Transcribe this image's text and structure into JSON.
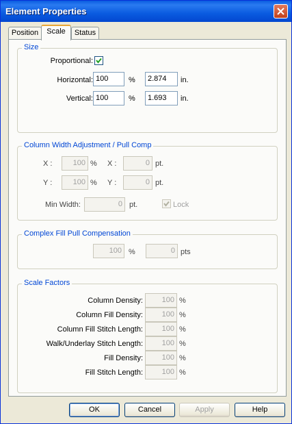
{
  "window": {
    "title": "Element Properties"
  },
  "tabs": [
    "Position",
    "Scale",
    "Status"
  ],
  "size": {
    "legend": "Size",
    "proportional_label": "Proportional:",
    "proportional_checked": true,
    "horizontal_label": "Horizontal:",
    "horizontal_value": "100",
    "horizontal_unit": "%",
    "horizontal_in": "2.874",
    "horizontal_in_unit": "in.",
    "vertical_label": "Vertical:",
    "vertical_value": "100",
    "vertical_unit": "%",
    "vertical_in": "1.693",
    "vertical_in_unit": "in."
  },
  "column": {
    "legend": "Column Width Adjustment / Pull Comp",
    "x_label": "X :",
    "x_pct": "100",
    "x_pct_unit": "%",
    "x_label2": "X :",
    "x_pt": "0",
    "x_pt_unit": "pt.",
    "y_label": "Y :",
    "y_pct": "100",
    "y_pct_unit": "%",
    "y_label2": "Y :",
    "y_pt": "0",
    "y_pt_unit": "pt.",
    "min_width_label": "Min Width:",
    "min_width": "0",
    "min_width_unit": "pt.",
    "lock_label": "Lock",
    "lock_checked": true
  },
  "complex_fill": {
    "legend": "Complex Fill Pull Compensation",
    "pct": "100",
    "pct_unit": "%",
    "pts": "0",
    "pts_unit": "pts"
  },
  "scale_factors": {
    "legend": "Scale Factors",
    "rows": [
      {
        "label": "Column Density:",
        "value": "100",
        "unit": "%"
      },
      {
        "label": "Column Fill Density:",
        "value": "100",
        "unit": "%"
      },
      {
        "label": "Column Fill Stitch Length:",
        "value": "100",
        "unit": "%"
      },
      {
        "label": "Walk/Underlay Stitch Length:",
        "value": "100",
        "unit": "%"
      },
      {
        "label": "Fill Density:",
        "value": "100",
        "unit": "%"
      },
      {
        "label": "Fill Stitch Length:",
        "value": "100",
        "unit": "%"
      }
    ]
  },
  "buttons": {
    "ok": "OK",
    "cancel": "Cancel",
    "apply": "Apply",
    "help": "Help"
  },
  "colors": {
    "title_bar": "#0a5be0",
    "legend_text": "#0046d5",
    "dialog_bg": "#ece9d8"
  }
}
